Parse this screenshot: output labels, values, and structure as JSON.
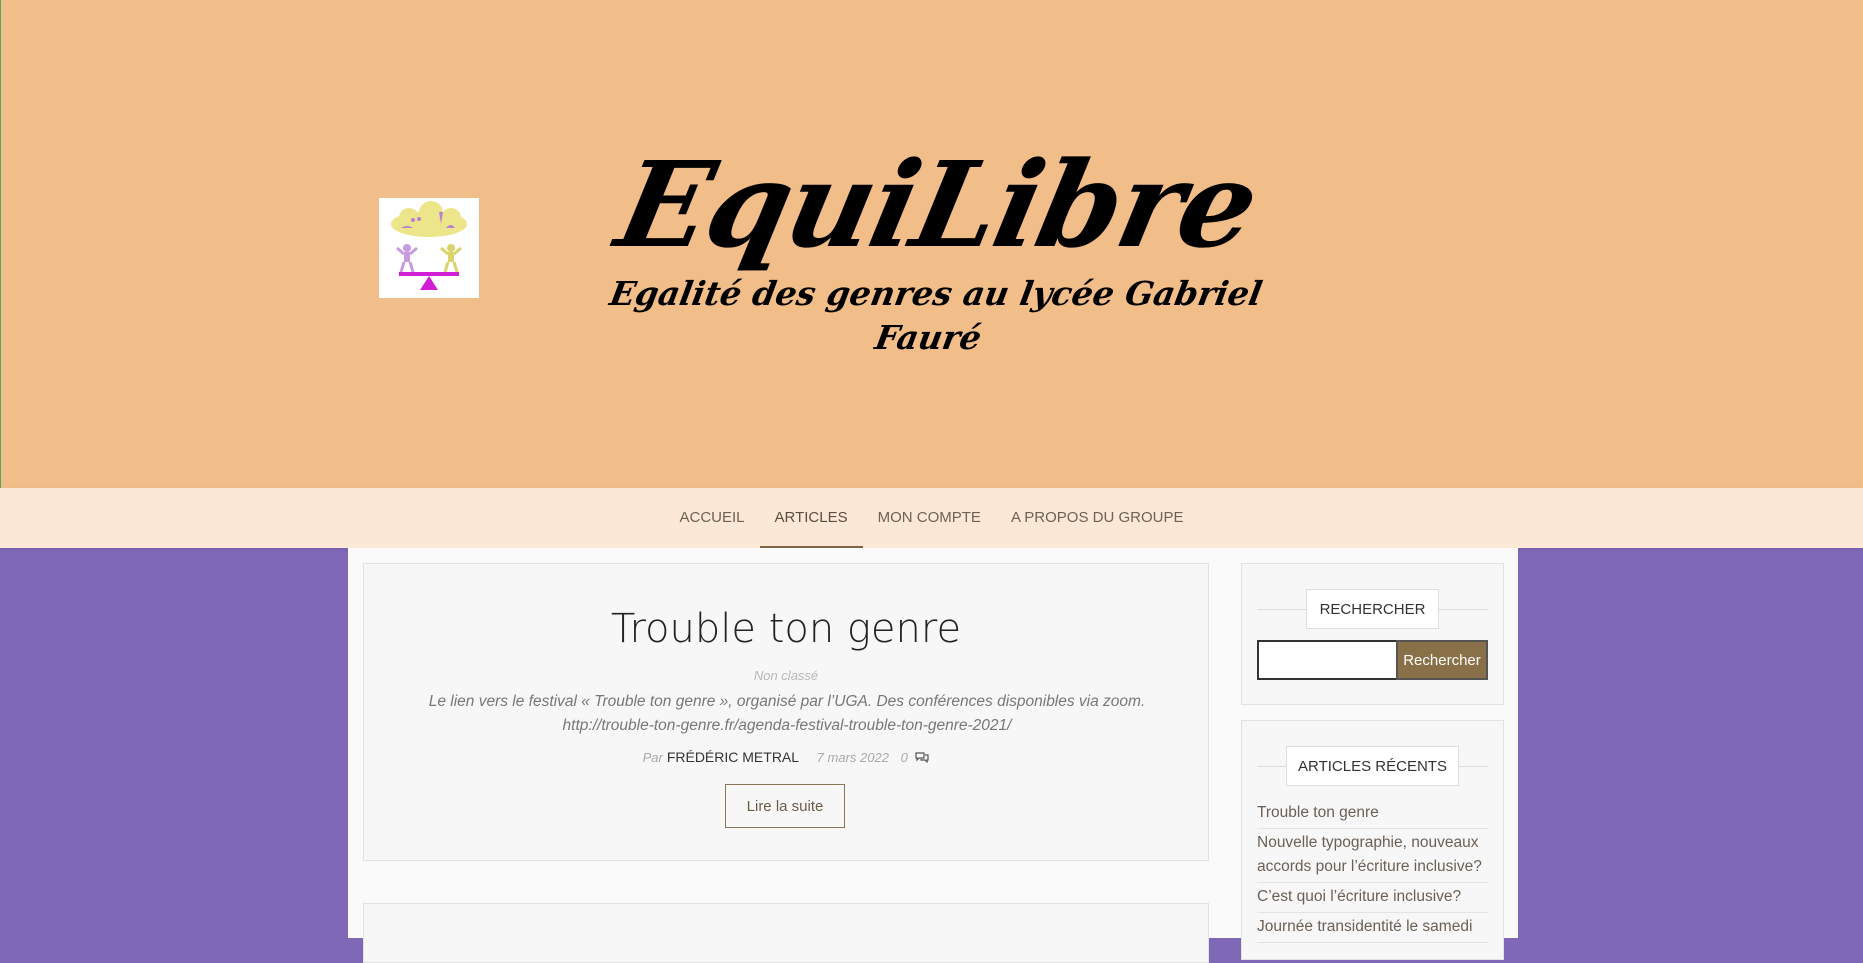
{
  "header": {
    "site_title": "EquiLibre",
    "tagline": "Egalité des genres au lycée Gabriel Fauré",
    "logo_icon": "balance-scale-logo-icon"
  },
  "nav": {
    "items": [
      {
        "label": "ACCUEIL",
        "active": false
      },
      {
        "label": "ARTICLES",
        "active": true
      },
      {
        "label": "MON COMPTE",
        "active": false
      },
      {
        "label": "A PROPOS DU GROUPE",
        "active": false
      }
    ]
  },
  "post": {
    "title": "Trouble ton genre",
    "category": "Non classé",
    "excerpt": "Le lien vers le festival « Trouble ton genre », organisé par l’UGA. Des conférences disponibles via zoom. http://trouble-ton-genre.fr/agenda-festival-trouble-ton-genre-2021/",
    "by_prefix": "Par",
    "author": "FRÉDÉRIC METRAL",
    "date": "7 mars 2022",
    "comments": "0",
    "comment_icon": "comments-icon",
    "read_more": "Lire la suite"
  },
  "sidebar": {
    "search": {
      "title": "RECHERCHER",
      "placeholder": "",
      "button": "Rechercher"
    },
    "recent": {
      "title": "ARTICLES RÉCENTS",
      "items": [
        "Trouble ton genre",
        "Nouvelle typographie, nouveaux accords pour l’écriture inclusive?",
        "C’est quoi l’écriture inclusive?",
        "Journée transidentité le samedi"
      ]
    }
  },
  "colors": {
    "header_bg": "#f1bd88",
    "nav_bg": "#fbe8d6",
    "page_bg": "#8068b8",
    "accent": "#8a7048"
  }
}
